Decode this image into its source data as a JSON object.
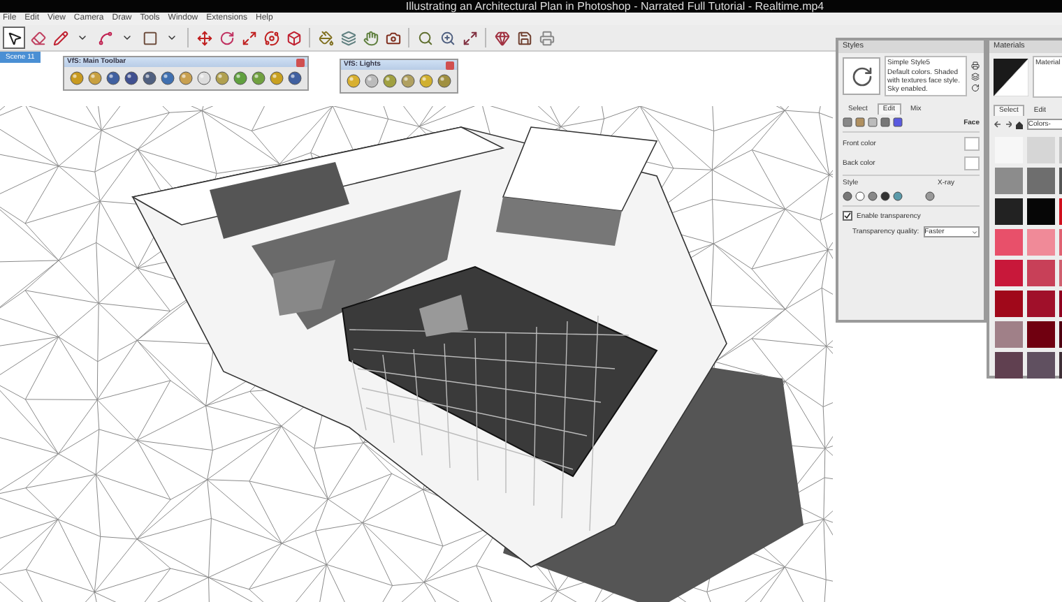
{
  "title_bar": {
    "title": "Illustrating an Architectural Plan in Photoshop - Narrated Full Tutorial - Realtime.mp4"
  },
  "menu_bar": [
    "File",
    "Edit",
    "View",
    "Camera",
    "Draw",
    "Tools",
    "Window",
    "Extensions",
    "Help"
  ],
  "scene_tabs": [
    {
      "label": "Scene 11",
      "selected": true
    }
  ],
  "floating_toolbars": [
    {
      "title": "VfS: Main Toolbar"
    },
    {
      "title": "VfS: Lights"
    }
  ],
  "styles_panel": {
    "title": "Styles",
    "style_name": "Simple Style5",
    "description": "Default colors. Shaded with textures face style. Sky enabled.",
    "tabs": [
      {
        "label": "Select",
        "selected": false
      },
      {
        "label": "Edit",
        "selected": true
      },
      {
        "label": "Mix",
        "selected": false
      }
    ],
    "section": "Face",
    "front_color": "Front color",
    "back_color": "Back color",
    "style_label": "Style",
    "xray_label": "X-ray",
    "transparency": {
      "label": "Enable transparency",
      "checked": true
    },
    "quality": {
      "label": "Transparency quality:",
      "value": "Faster"
    }
  },
  "materials_panel": {
    "title": "Materials",
    "name": "Material",
    "tabs": [
      {
        "label": "Select",
        "selected": true
      },
      {
        "label": "Edit",
        "selected": false
      }
    ],
    "library": "Colors-",
    "swatches": [
      {
        "color": "#f7f7f7"
      },
      {
        "color": "#d6d6d6"
      },
      {
        "color": "#c2c2c2"
      },
      {
        "color": "#8c8c8c"
      },
      {
        "color": "#6e6e6e"
      },
      {
        "color": "#555555"
      },
      {
        "color": "#222222"
      },
      {
        "color": "#060606"
      },
      {
        "color": "#d0101e"
      },
      {
        "color": "#e8506a"
      },
      {
        "color": "#f08a98"
      },
      {
        "color": "#e06272"
      },
      {
        "color": "#c8183a"
      },
      {
        "color": "#c84058"
      },
      {
        "color": "#d06070"
      },
      {
        "color": "#a0081a"
      },
      {
        "color": "#a0102a"
      },
      {
        "color": "#900020"
      },
      {
        "color": "#a08088"
      },
      {
        "color": "#700010"
      },
      {
        "color": "#500012"
      },
      {
        "color": "#604050"
      },
      {
        "color": "#605060"
      },
      {
        "color": "#403038"
      }
    ]
  }
}
